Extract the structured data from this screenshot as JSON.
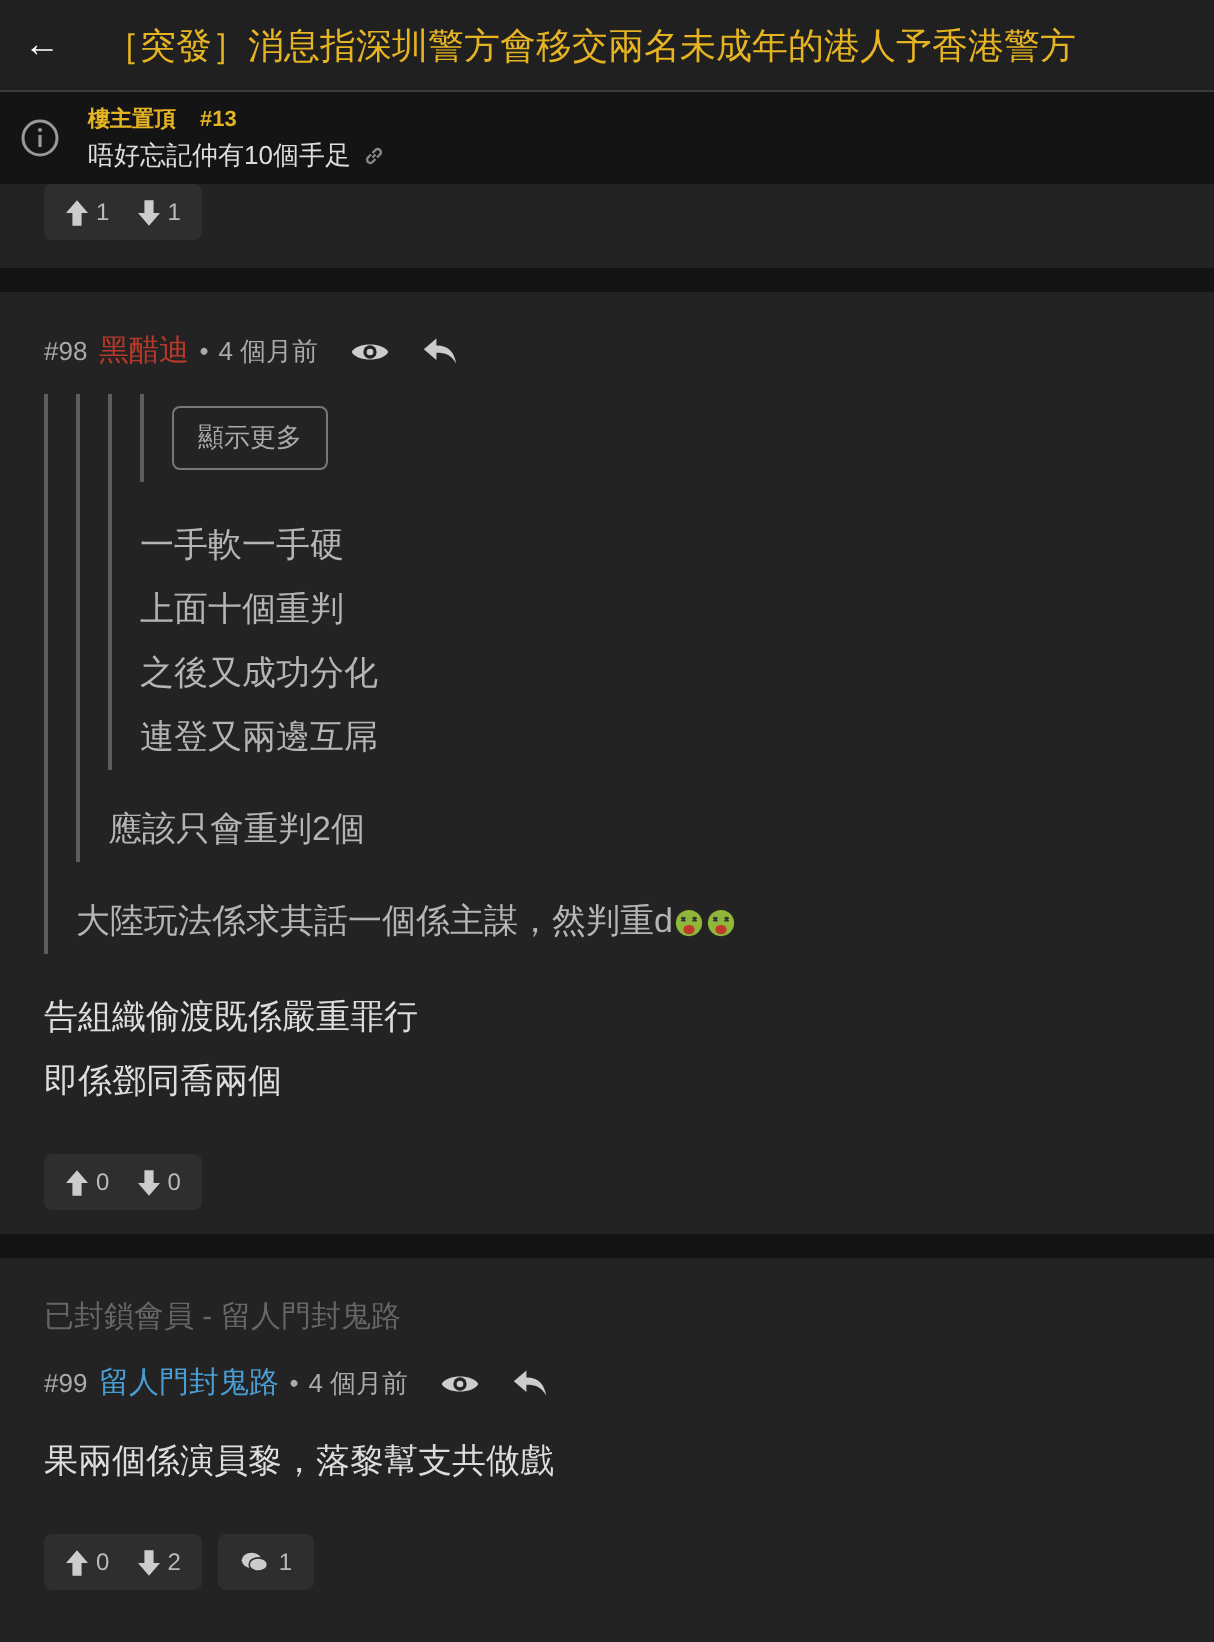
{
  "header": {
    "back": "←",
    "title": "［突發］消息指深圳警方會移交兩名未成年的港人予香港警方"
  },
  "pinned": {
    "label": "樓主置頂",
    "number": "#13",
    "text": "唔好忘記仲有10個手足"
  },
  "posts": [
    {
      "votes": {
        "up": "1",
        "down": "1"
      }
    },
    {
      "number": "#98",
      "author": "黑醋迪",
      "color": "#b8392b",
      "separator": "•",
      "time": "4 個月前",
      "quote": {
        "quote": {
          "quote": {
            "quote": {
              "button": "顯示更多"
            },
            "lines": [
              {
                "kind": "text",
                "text": "一手軟一手硬"
              },
              {
                "kind": "text",
                "text": "上面十個重判"
              },
              {
                "kind": "text",
                "text": "之後又成功分化"
              },
              {
                "kind": "text",
                "text": "連登又兩邊互屌"
              }
            ]
          },
          "lines": [
            {
              "kind": "text",
              "text": "應該只會重判2個"
            }
          ]
        },
        "lines": [
          {
            "kind": "emoji",
            "text": "大陸玩法係求其話一個係主謀，然判重d"
          }
        ]
      },
      "body": [
        "告組織偷渡既係嚴重罪行",
        "即係鄧同喬兩個"
      ],
      "votes": {
        "up": "0",
        "down": "0"
      }
    },
    {
      "blocked": "已封鎖會員  -  留人門封鬼路",
      "number": "#99",
      "author": "留人門封鬼路",
      "color": "#4a9ed6",
      "separator": "•",
      "time": "4 個月前",
      "body": [
        "果兩個係演員黎，落黎幫支共做戲"
      ],
      "votes": {
        "up": "0",
        "down": "2"
      },
      "replies": "1"
    }
  ]
}
